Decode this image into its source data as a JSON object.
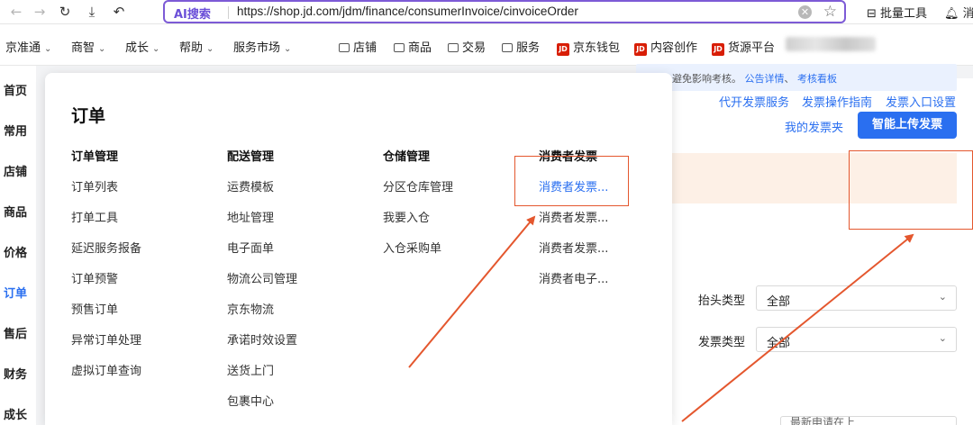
{
  "browser": {
    "ai_label": "AI搜索",
    "url": "https://shop.jd.com/jdm/finance/consumerInvoice/cinvoiceOrder",
    "tools": [
      "批量工具",
      "消"
    ]
  },
  "bookmarks": {
    "menus": [
      "京准通",
      "商智",
      "成长",
      "帮助",
      "服务市场"
    ],
    "folders": [
      "店铺",
      "商品",
      "交易",
      "服务"
    ],
    "jd_items": [
      "京东钱包",
      "内容创作",
      "货源平台"
    ],
    "jd_icon_text": "JD"
  },
  "sidebar": {
    "items": [
      "首页",
      "常用",
      "店铺",
      "商品",
      "价格",
      "订单",
      "售后",
      "财务",
      "成长"
    ],
    "active_index": 5
  },
  "page": {
    "top_links": [
      "代开发票服务",
      "发票操作指南",
      "发票入口设置"
    ],
    "notice": {
      "text": "避免影响考核。",
      "link1": "公告详情",
      "sep": "、",
      "link2": "考核看板"
    },
    "my_invoice_link": "我的发票夹",
    "upload_button": "智能上传发票",
    "filters": [
      {
        "label": "抬头类型",
        "value": "全部"
      },
      {
        "label": "发票类型",
        "value": "全部"
      }
    ],
    "partial_select": "最新申请在上"
  },
  "mega_menu": {
    "title": "订单",
    "columns": [
      {
        "heading": "订单管理",
        "items": [
          "订单列表",
          "打单工具",
          "延迟服务报备",
          "订单预警",
          "预售订单",
          "异常订单处理",
          "虚拟订单查询"
        ]
      },
      {
        "heading": "配送管理",
        "items": [
          "运费模板",
          "地址管理",
          "电子面单",
          "物流公司管理",
          "京东物流",
          "承诺时效设置",
          "送货上门",
          "包裹中心"
        ]
      },
      {
        "heading": "仓储管理",
        "items": [
          "分区仓库管理",
          "我要入仓",
          "入仓采购单"
        ]
      },
      {
        "heading": "消费者发票",
        "items": [
          "消费者发票...",
          "消费者发票...",
          "消费者发票...",
          "消费者电子..."
        ]
      }
    ]
  },
  "colors": {
    "accent": "#2a6ff0",
    "annotation": "#e4572e",
    "ai_purple": "#6b4fd8"
  }
}
